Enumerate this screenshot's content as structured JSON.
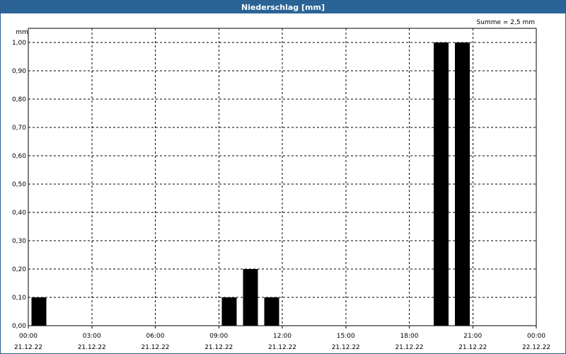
{
  "window": {
    "title": "Niederschlag [mm]"
  },
  "chart_data": {
    "type": "bar",
    "title": "Niederschlag [mm]",
    "unit_label": "mm",
    "sum_label": "Summe = 2,5 mm",
    "ylim": [
      0,
      1.0
    ],
    "y_ticks": [
      0,
      0.1,
      0.2,
      0.3,
      0.4,
      0.5,
      0.6,
      0.7,
      0.8,
      0.9,
      1.0
    ],
    "y_tick_labels": [
      "0,00",
      "0,10",
      "0,20",
      "0,30",
      "0,40",
      "0,50",
      "0,60",
      "0,70",
      "0,80",
      "0,90",
      "1,00"
    ],
    "x_range_hours": [
      0,
      24
    ],
    "x_ticks_hours": [
      0,
      3,
      6,
      9,
      12,
      15,
      18,
      21,
      24
    ],
    "x_tick_times": [
      "00:00",
      "03:00",
      "06:00",
      "09:00",
      "12:00",
      "15:00",
      "18:00",
      "21:00",
      "00:00"
    ],
    "x_tick_dates": [
      "21.12.22",
      "21.12.22",
      "21.12.22",
      "21.12.22",
      "21.12.22",
      "21.12.22",
      "21.12.22",
      "21.12.22",
      "22.12.22"
    ],
    "grid": true,
    "bar_color": "#000000",
    "bars": [
      {
        "time": "00:30",
        "hour": 0.5,
        "value": 0.1
      },
      {
        "time": "09:30",
        "hour": 9.5,
        "value": 0.1
      },
      {
        "time": "10:30",
        "hour": 10.5,
        "value": 0.2
      },
      {
        "time": "11:30",
        "hour": 11.5,
        "value": 0.1
      },
      {
        "time": "19:30",
        "hour": 19.5,
        "value": 1.0
      },
      {
        "time": "20:30",
        "hour": 20.5,
        "value": 1.0
      }
    ]
  }
}
